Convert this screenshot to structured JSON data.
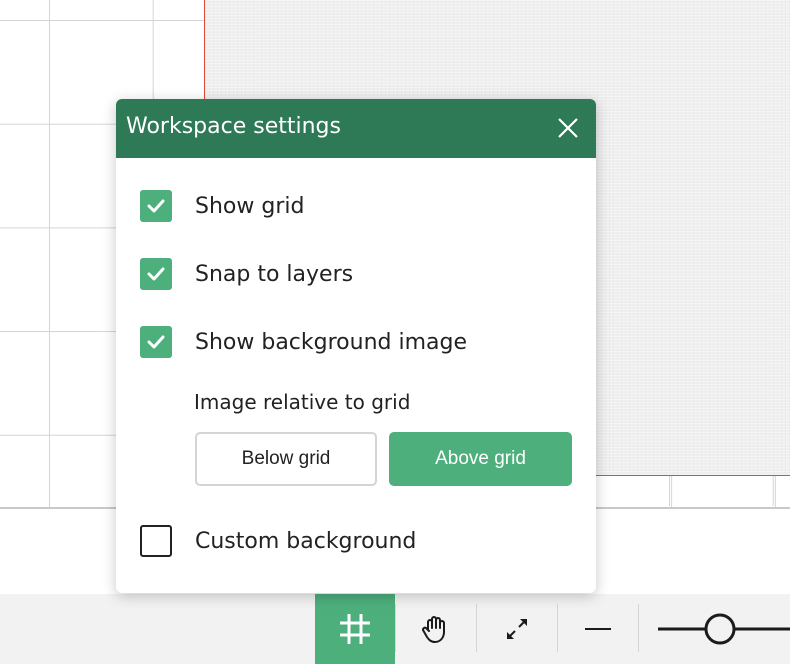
{
  "dialog": {
    "title": "Workspace settings",
    "options": [
      {
        "label": "Show grid",
        "checked": true
      },
      {
        "label": "Snap to layers",
        "checked": true
      },
      {
        "label": "Show background image",
        "checked": true
      }
    ],
    "image_relative_label": "Image relative to grid",
    "buttons": {
      "below_grid": "Below grid",
      "above_grid": "Above grid",
      "selected": "above_grid"
    },
    "custom_background": {
      "label": "Custom background",
      "checked": false
    }
  },
  "toolbar": {
    "tools": [
      {
        "icon": "grid-icon",
        "active": true
      },
      {
        "icon": "hand-icon",
        "active": false
      },
      {
        "icon": "expand-icon",
        "active": false
      },
      {
        "icon": "minus-icon",
        "active": false
      },
      {
        "icon": "zoom-slider",
        "active": false
      }
    ]
  },
  "colors": {
    "header": "#2e7a57",
    "accent": "#4daf7c",
    "print_area_border": "#e04a3a"
  }
}
